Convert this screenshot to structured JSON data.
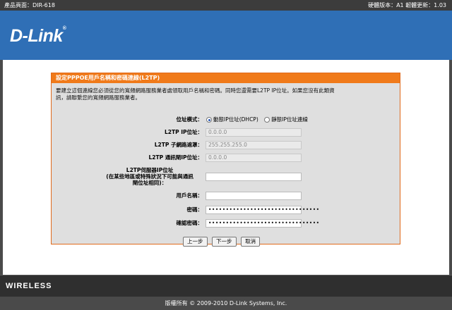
{
  "topbar": {
    "product": "產品頁面：DIR-618",
    "versions": "硬體版本：A1   韌體更新：1.03"
  },
  "header": {
    "logo": "D-Link",
    "logo_mark": "®"
  },
  "panel": {
    "title": "設定PPPOE用戶名稱和密碼連線(L2TP)",
    "desc_line1": "要建立這個連線您必須從您的寬頻網路服務業者處領取用戶名稱和密碼。同時您還需要L2TP IP位址。如果您沒有此類資",
    "desc_line2": "訊，請聯繫您的寬頻網路服務業者。"
  },
  "form": {
    "address_mode_label": "位址模式：",
    "address_mode_dynamic": "動態IP位址(DHCP)",
    "address_mode_static": "靜態IP位址連線",
    "l2tp_ip_label": "L2TP IP位址：",
    "l2tp_ip_value": "0.0.0.0",
    "subnet_label": "L2TP 子網路遮罩：",
    "subnet_value": "255.255.255.0",
    "gateway_label": "L2TP 通訊閘IP位址：",
    "gateway_value": "0.0.0.0",
    "server_label_1": "L2TP伺服器IP位址",
    "server_label_2": "(在某些地區或特殊狀況下可能與通訊",
    "server_label_3": "閘位址相同)：",
    "server_value": "",
    "username_label": "用戶名稱：",
    "username_value": "",
    "password_label": "密碼：",
    "password_value": "••••••••••••••••••••••••••••••••",
    "confirm_label": "確認密碼：",
    "confirm_value": "••••••••••••••••••••••••••••••••"
  },
  "buttons": {
    "prev": "上一步",
    "next": "下一步",
    "cancel": "取消"
  },
  "brand_bar": {
    "label": "WIRELESS"
  },
  "footer": {
    "copyright": "版權所有 © 2009-2010 D-Link Systems, Inc."
  }
}
